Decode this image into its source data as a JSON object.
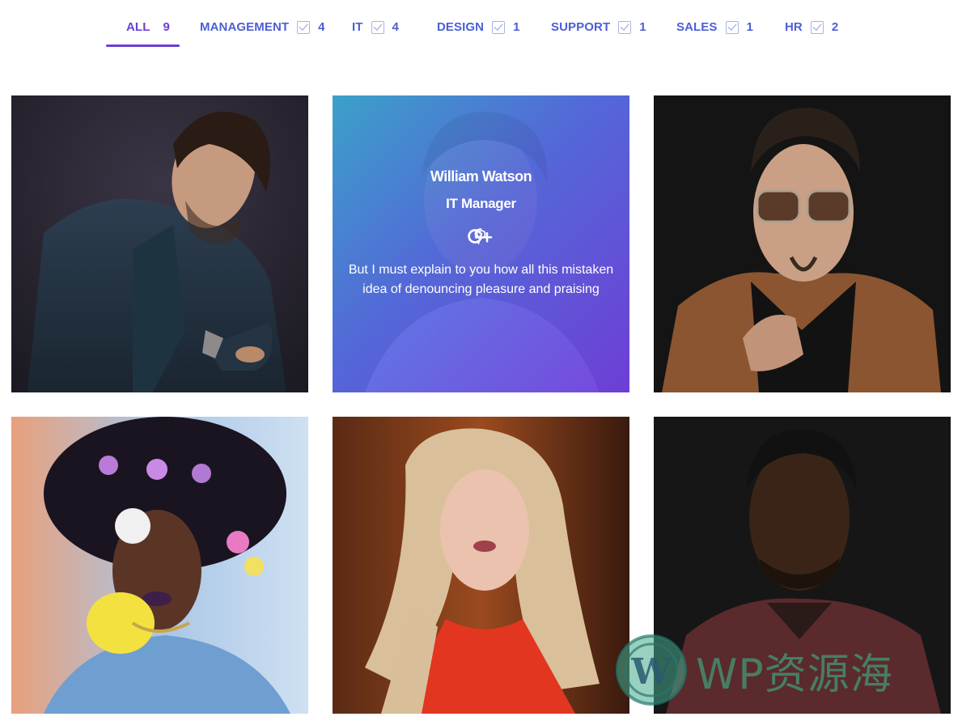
{
  "filters": [
    {
      "label": "ALL",
      "count": "9",
      "active": true
    },
    {
      "label": "MANAGEMENT",
      "count": "4"
    },
    {
      "label": "IT",
      "count": "4"
    },
    {
      "label": "DESIGN",
      "count": "1"
    },
    {
      "label": "SUPPORT",
      "count": "1"
    },
    {
      "label": "SALES",
      "count": "1"
    },
    {
      "label": "HR",
      "count": "2"
    }
  ],
  "team": [
    {
      "photo": "man-in-navy-blazer-portrait"
    },
    {
      "photo": "man-portrait-hover",
      "name": "William Watson",
      "role": "IT Manager",
      "social": [
        "pinterest-icon",
        "google-plus-icon"
      ],
      "bio": "But I must explain to you how all this mistaken idea of denouncing pleasure and praising"
    },
    {
      "photo": "man-with-sunglasses-leather-jacket"
    },
    {
      "photo": "woman-with-flowers-in-hair"
    },
    {
      "photo": "blonde-woman-red-top"
    },
    {
      "photo": "man-in-maroon-sweater"
    }
  ],
  "watermark": {
    "text": "WP资源海"
  },
  "colors": {
    "accent": "#6b3fd4",
    "filter_text": "#4c5fd5",
    "overlay_start": "#36aad2",
    "overlay_end": "#703adc"
  }
}
